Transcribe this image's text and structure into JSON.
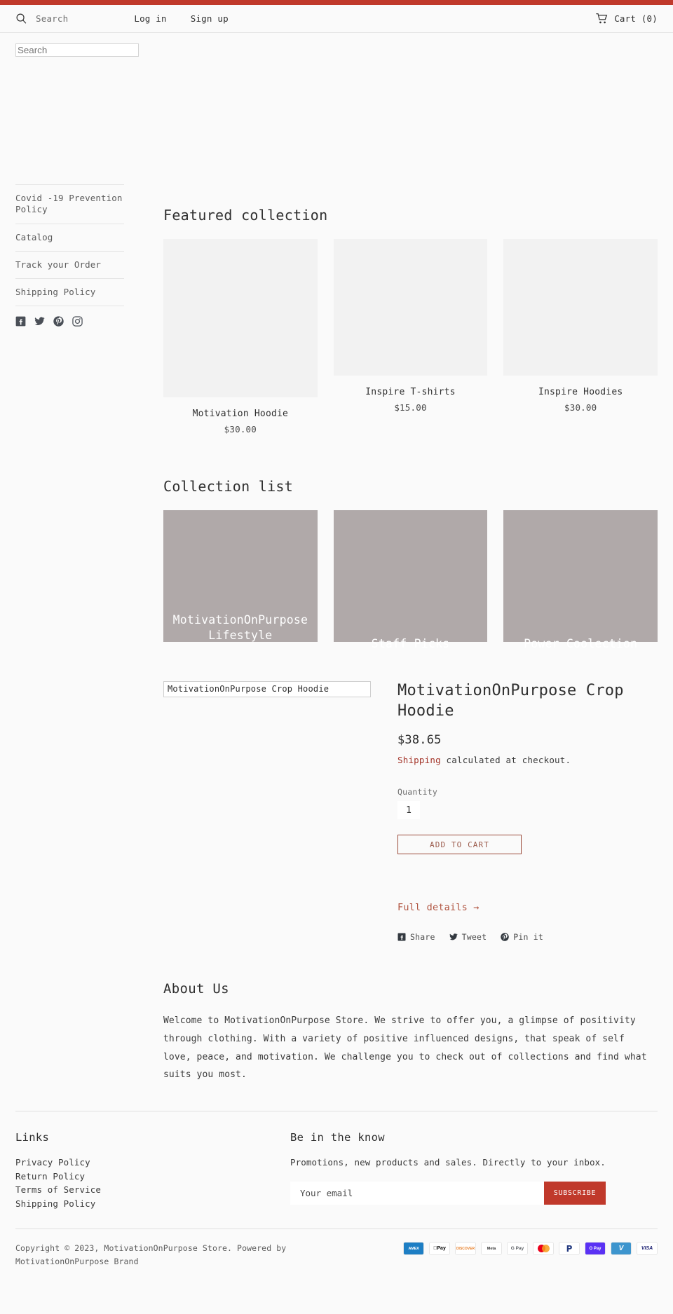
{
  "theme": {
    "accent_bar_color": "#c0392b",
    "link_red": "#a4352a",
    "collection_tile_color": "#b0a9a9",
    "subscribe_button_color": "#c0392b"
  },
  "header": {
    "search_label": "Search",
    "search_placeholder": "Search",
    "nav": [
      {
        "label": "Log in"
      },
      {
        "label": "Sign up"
      }
    ],
    "cart_label": "Cart (0)",
    "icons": {
      "search": "search-icon",
      "cart": "cart-icon"
    }
  },
  "sidebar": {
    "items": [
      {
        "label": "Covid -19 Prevention Policy"
      },
      {
        "label": "Catalog"
      },
      {
        "label": "Track your Order"
      },
      {
        "label": "Shipping Policy"
      }
    ],
    "social": [
      {
        "name": "facebook-icon"
      },
      {
        "name": "twitter-icon"
      },
      {
        "name": "pinterest-icon"
      },
      {
        "name": "instagram-icon"
      }
    ]
  },
  "featured": {
    "title": "Featured collection",
    "products": [
      {
        "name": "Motivation Hoodie",
        "price": "$30.00"
      },
      {
        "name": "Inspire T-shirts",
        "price": "$15.00"
      },
      {
        "name": "Inspire Hoodies",
        "price": "$30.00"
      }
    ]
  },
  "collections": {
    "title": "Collection list",
    "items": [
      {
        "label": "MotivationOnPurpose Lifestyle"
      },
      {
        "label": "Staff Picks"
      },
      {
        "label": "Power Coolection"
      }
    ]
  },
  "feature_product": {
    "image_alt": "MotivationOnPurpose Crop Hoodie",
    "title": "MotivationOnPurpose Crop Hoodie",
    "price": "$38.65",
    "shipping_link": "Shipping",
    "shipping_rest": " calculated at checkout.",
    "quantity_label": "Quantity",
    "quantity_value": "1",
    "add_to_cart_label": "ADD TO CART",
    "full_details_label": "Full details →",
    "share": [
      {
        "label": "Share",
        "icon": "facebook-icon"
      },
      {
        "label": "Tweet",
        "icon": "twitter-icon"
      },
      {
        "label": "Pin it",
        "icon": "pinterest-icon"
      }
    ]
  },
  "about": {
    "title": "About Us",
    "text": "Welcome to MotivationOnPurpose Store. We strive to offer you, a glimpse of positivity through clothing. With a variety of positive influenced designs, that speak of self love, peace, and motivation. We challenge you to check out of collections and find what suits you most."
  },
  "footer": {
    "links_heading": "Links",
    "links": [
      {
        "label": "Privacy Policy"
      },
      {
        "label": "Return Policy"
      },
      {
        "label": "Terms of Service"
      },
      {
        "label": "Shipping Policy"
      }
    ],
    "newsletter_heading": "Be in the know",
    "newsletter_text": "Promotions, new products and sales. Directly to your inbox.",
    "email_placeholder": "Your email",
    "subscribe_label": "SUBSCRIBE",
    "copyright": "Copyright © 2023, MotivationOnPurpose Store. Powered by MotivationOnPurpose Brand",
    "payment_methods": [
      {
        "name": "amex",
        "label": "AMEX"
      },
      {
        "name": "apple-pay",
        "label": "Pay"
      },
      {
        "name": "discover",
        "label": "DISCOVER"
      },
      {
        "name": "meta-pay",
        "label": "Meta"
      },
      {
        "name": "google-pay",
        "label": "G Pay"
      },
      {
        "name": "mastercard",
        "label": ""
      },
      {
        "name": "paypal",
        "label": "P"
      },
      {
        "name": "shop-pay",
        "label": "O Pay"
      },
      {
        "name": "venmo",
        "label": "V"
      },
      {
        "name": "visa",
        "label": "VISA"
      }
    ]
  }
}
